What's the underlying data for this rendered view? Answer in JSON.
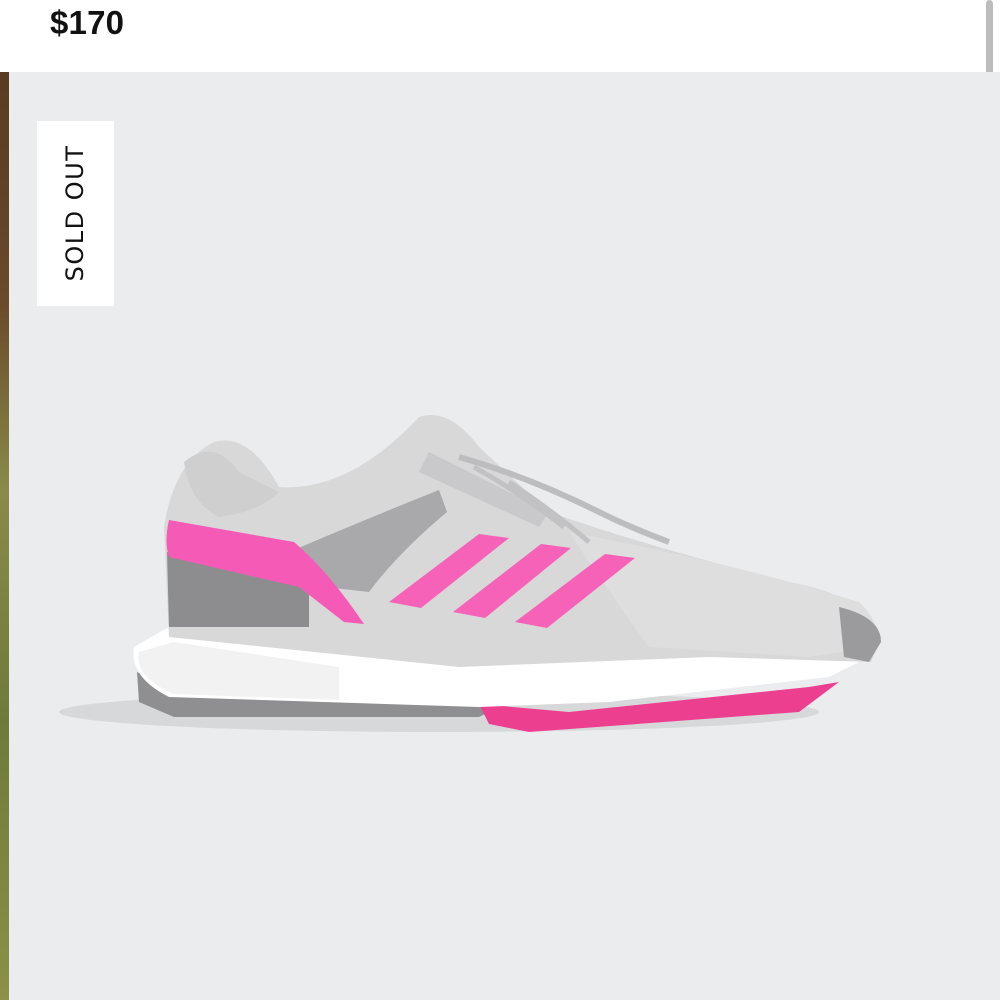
{
  "product": {
    "price": "$170",
    "badge": "SOLD OUT",
    "image": {
      "description_icon": "golf-shoe-image",
      "colors": {
        "background": "#ebecee",
        "upper": "#d6d6d6",
        "stripes": "#f562b8",
        "heel_accent": "#f55ab6",
        "midsole": "#ffffff",
        "outsole_pink": "#ec3f8f"
      }
    }
  }
}
